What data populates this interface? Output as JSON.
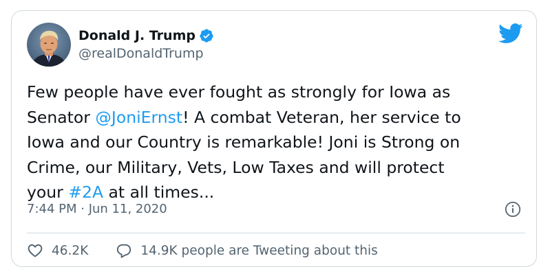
{
  "author": {
    "display_name": "Donald J. Trump",
    "handle": "@realDonaldTrump",
    "verified": true,
    "avatar_icon": "profile-photo"
  },
  "brand": {
    "icon": "twitter-bird-icon",
    "color": "#1d9bf0"
  },
  "tweet": {
    "lines": [
      [
        {
          "text": "Few people have ever fought as strongly for Iowa as",
          "link": false
        }
      ],
      [
        {
          "text": "Senator ",
          "link": false
        },
        {
          "text": "@JoniErnst",
          "link": true
        },
        {
          "text": "! A combat Veteran, her service to",
          "link": false
        }
      ],
      [
        {
          "text": "Iowa and our Country is remarkable! Joni is Strong on",
          "link": false
        }
      ],
      [
        {
          "text": "Crime, our Military, Vets, Low Taxes and will protect",
          "link": false
        }
      ],
      [
        {
          "text": "your ",
          "link": false
        },
        {
          "text": "#2A",
          "link": true
        },
        {
          "text": " at all times...",
          "link": false
        }
      ]
    ],
    "timestamp": "7:44 PM · Jun 11, 2020"
  },
  "actions": {
    "likes": "46.2K",
    "retweet_text": "14.9K people are Tweeting about this",
    "like_icon": "heart-icon",
    "reply_icon": "speech-bubble-icon",
    "info_icon": "info-icon"
  },
  "colors": {
    "text": "#0f1419",
    "secondary": "#536471",
    "link": "#1d9bf0",
    "border": "#cfd9de"
  }
}
